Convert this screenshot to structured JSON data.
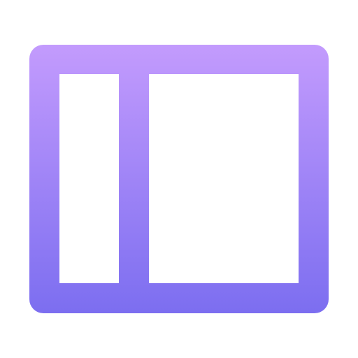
{
  "icon": {
    "name": "sidebar-layout-icon",
    "gradient_top": "#C39BFD",
    "gradient_bottom": "#7C6EF0",
    "background": "#FFFFFF"
  }
}
